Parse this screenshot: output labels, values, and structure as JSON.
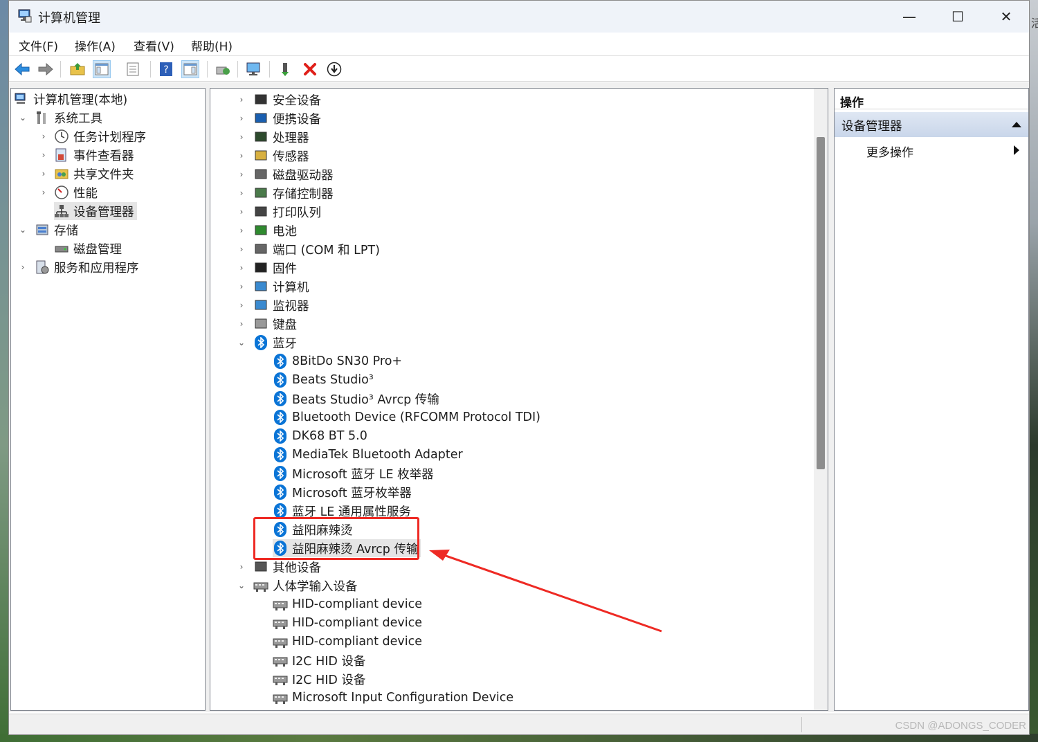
{
  "window": {
    "title": "计算机管理",
    "controls": {
      "minimize": "—",
      "maximize": "☐",
      "close": "✕"
    }
  },
  "menu": [
    "文件(F)",
    "操作(A)",
    "查看(V)",
    "帮助(H)"
  ],
  "left_tree": {
    "root": "计算机管理(本地)",
    "system_tools": "系统工具",
    "task_scheduler": "任务计划程序",
    "event_viewer": "事件查看器",
    "shared_folders": "共享文件夹",
    "performance": "性能",
    "device_manager": "设备管理器",
    "storage": "存储",
    "disk_management": "磁盘管理",
    "services_apps": "服务和应用程序"
  },
  "device_tree": {
    "categories_before": [
      "安全设备",
      "便携设备",
      "处理器",
      "传感器",
      "磁盘驱动器",
      "存储控制器",
      "打印队列",
      "电池",
      "端口 (COM 和 LPT)",
      "固件",
      "计算机",
      "监视器",
      "键盘"
    ],
    "bluetooth": {
      "label": "蓝牙",
      "devices": [
        "8BitDo SN30 Pro+",
        "Beats Studio³",
        "Beats Studio³ Avrcp 传输",
        "Bluetooth Device (RFCOMM Protocol TDI)",
        "DK68 BT 5.0",
        "MediaTek Bluetooth Adapter",
        "Microsoft 蓝牙 LE 枚举器",
        "Microsoft 蓝牙枚举器",
        "蓝牙 LE 通用属性服务",
        "益阳麻辣烫",
        "益阳麻辣烫 Avrcp 传输"
      ]
    },
    "other_devices": "其他设备",
    "hid": {
      "label": "人体学输入设备",
      "devices": [
        "HID-compliant device",
        "HID-compliant device",
        "HID-compliant device",
        "I2C HID 设备",
        "I2C HID 设备",
        "Microsoft Input Configuration Device"
      ]
    }
  },
  "actions": {
    "header": "操作",
    "section": "设备管理器",
    "more": "更多操作"
  },
  "watermark": "CSDN @ADONGS_CODER",
  "desktop_partial_text": "活",
  "colors": {
    "bluetooth": "#0a74d6",
    "annotation": "#ee2a24",
    "selection": "#e5e5e5"
  }
}
